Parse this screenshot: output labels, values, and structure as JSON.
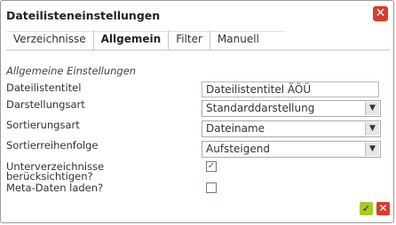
{
  "dialog": {
    "title": "Dateilisteneinstellungen",
    "close_icon": "✕"
  },
  "tabs": [
    {
      "label": "Verzeichnisse",
      "active": false
    },
    {
      "label": "Allgemein",
      "active": true
    },
    {
      "label": "Filter",
      "active": false
    },
    {
      "label": "Manuell",
      "active": false
    }
  ],
  "section_title": "Allgemeine Einstellungen",
  "fields": {
    "title": {
      "label": "Dateilistentitel",
      "value": "Dateilistentitel ÄÖÜ"
    },
    "display_type": {
      "label": "Darstellungsart",
      "value": "Standarddarstellung"
    },
    "sort_type": {
      "label": "Sortierungsart",
      "value": "Dateiname"
    },
    "sort_order": {
      "label": "Sortierreihenfolge",
      "value": "Aufsteigend"
    },
    "subdirs": {
      "label_line1": "Unterverzeichnisse",
      "label_line2": "berücksichtigen?",
      "checked": true
    },
    "metadata": {
      "label": "Meta-Daten laden?",
      "checked": false
    }
  },
  "footer": {
    "ok_icon": "✓",
    "cancel_icon": "✕"
  },
  "colors": {
    "close": "#d63d2e",
    "ok": "#a8c928"
  }
}
